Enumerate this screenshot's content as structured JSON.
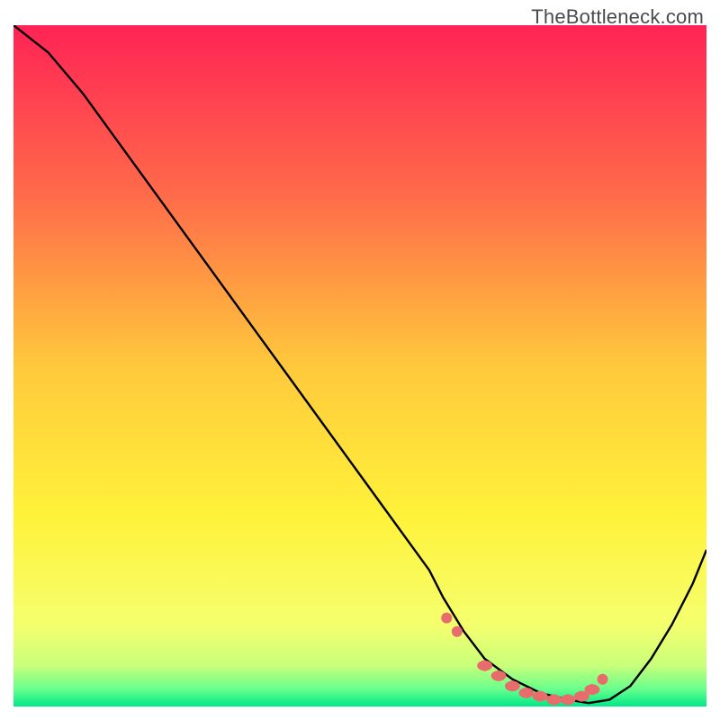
{
  "watermark": "TheBottleneck.com",
  "chart_data": {
    "type": "line",
    "title": "",
    "xlabel": "",
    "ylabel": "",
    "xlim": [
      0,
      100
    ],
    "ylim": [
      0,
      100
    ],
    "background_gradient_stops": [
      {
        "offset": 0,
        "color": "#ff2355"
      },
      {
        "offset": 0.25,
        "color": "#ff6b4a"
      },
      {
        "offset": 0.5,
        "color": "#ffc93c"
      },
      {
        "offset": 0.72,
        "color": "#fff23a"
      },
      {
        "offset": 0.88,
        "color": "#f5ff6e"
      },
      {
        "offset": 0.94,
        "color": "#c8ff7a"
      },
      {
        "offset": 0.975,
        "color": "#66ff8c"
      },
      {
        "offset": 1.0,
        "color": "#00e887"
      }
    ],
    "curve": {
      "x": [
        0,
        5,
        10,
        15,
        20,
        25,
        30,
        35,
        40,
        45,
        50,
        55,
        60,
        62,
        65,
        68,
        72,
        76,
        80,
        83,
        86,
        89,
        92,
        95,
        98,
        100
      ],
      "y": [
        100,
        96,
        90,
        83,
        76,
        69,
        62,
        55,
        48,
        41,
        34,
        27,
        20,
        16,
        11,
        7,
        4,
        2,
        1,
        0.5,
        1,
        3,
        7,
        12,
        18,
        23
      ]
    },
    "marker_points": {
      "x": [
        62.5,
        64,
        68,
        70,
        72,
        74,
        76,
        78,
        80,
        82,
        83.5,
        85
      ],
      "y": [
        13,
        11,
        6,
        4.5,
        3,
        2,
        1.5,
        1,
        1,
        1.5,
        2.5,
        4
      ],
      "color": "#e86c6c",
      "size": 6
    }
  }
}
